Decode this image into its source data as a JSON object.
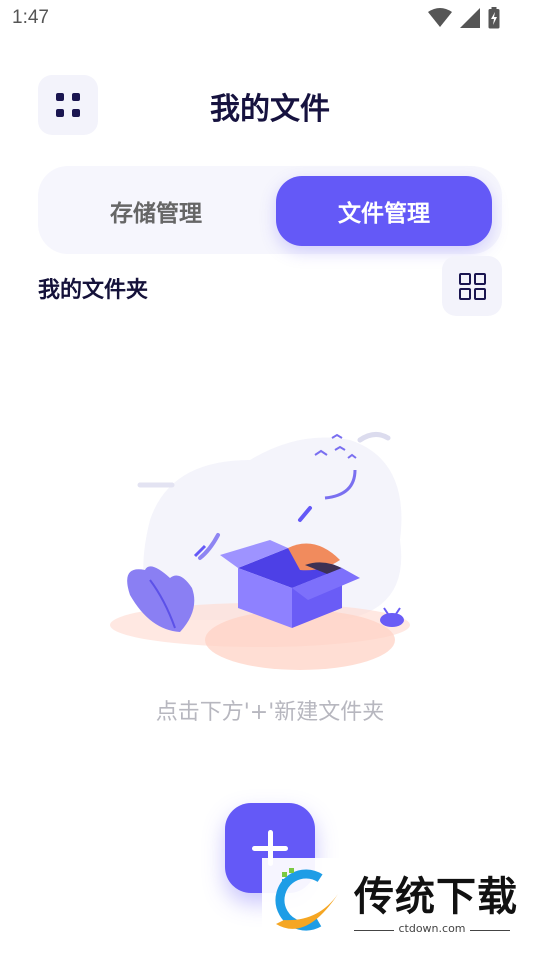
{
  "status_bar": {
    "time": "1:47",
    "icons": [
      "wifi-icon",
      "signal-icon",
      "battery-charging-icon"
    ]
  },
  "header": {
    "title": "我的文件",
    "menu_icon": "grid-dots-icon"
  },
  "tabs": [
    {
      "label": "存储管理",
      "active": false
    },
    {
      "label": "文件管理",
      "active": true
    }
  ],
  "section": {
    "title": "我的文件夹",
    "view_toggle_icon": "grid-view-icon"
  },
  "empty_state": {
    "illustration": "open-box-icon",
    "hint": "点击下方'+'新建文件夹"
  },
  "fab": {
    "icon": "plus-icon"
  },
  "watermark": {
    "brand": "传统下载",
    "url": "ctdown.com"
  },
  "colors": {
    "accent": "#6459f7",
    "title": "#16123f",
    "muted": "#b7b7bf",
    "surface": "#f3f3fb"
  }
}
